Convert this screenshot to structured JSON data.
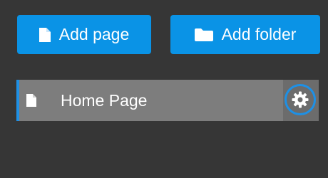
{
  "toolbar": {
    "add_page_label": "Add page",
    "add_folder_label": "Add folder"
  },
  "pages": [
    {
      "label": "Home Page"
    }
  ],
  "icons": {
    "add_page": "document-icon",
    "add_folder": "folder-icon",
    "page": "document-icon",
    "settings": "gear-icon"
  },
  "colors": {
    "background": "#363636",
    "accent": "#0a93e6",
    "selected_border": "#1e90e5",
    "row": "#7d7d7d"
  }
}
